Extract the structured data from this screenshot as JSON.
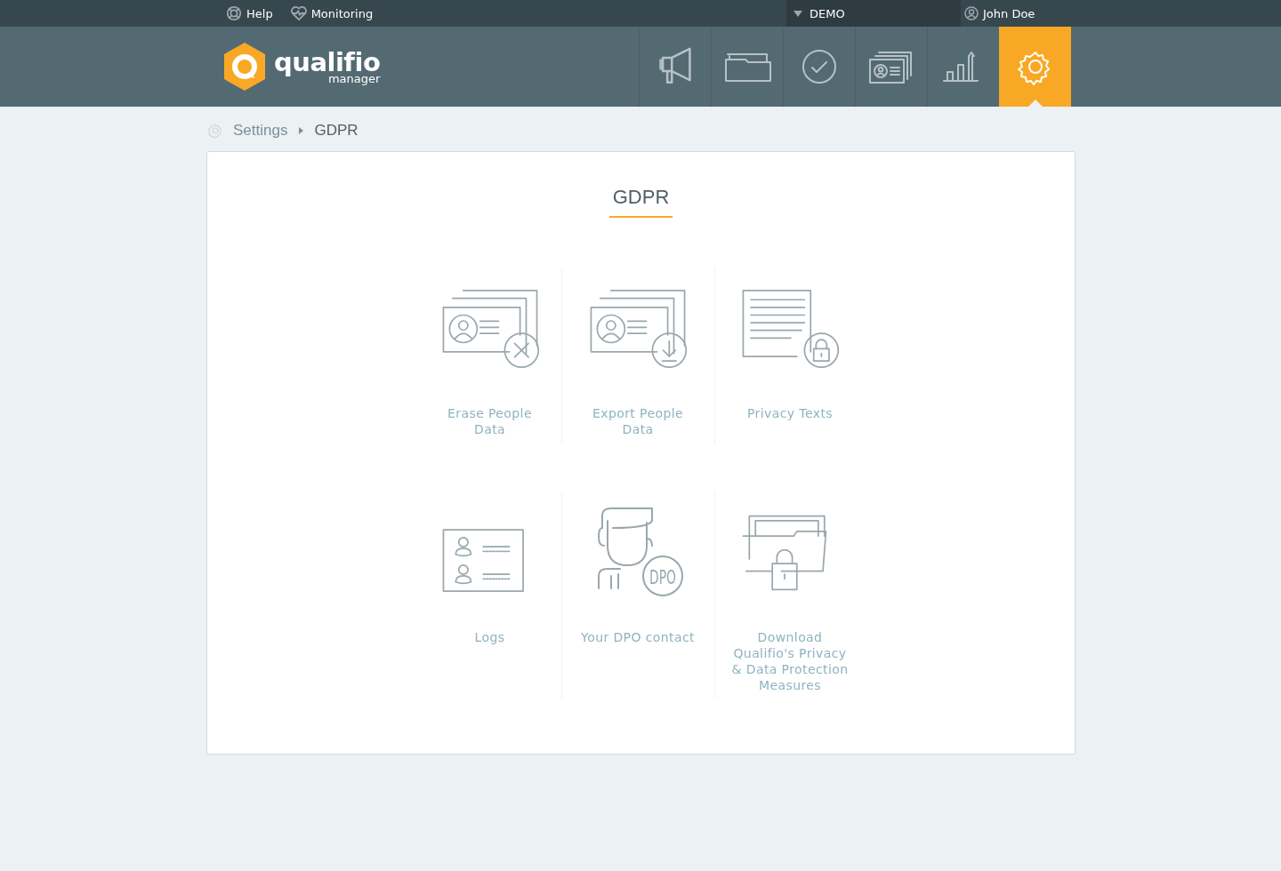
{
  "top_bar": {
    "links": [
      {
        "kind": "help",
        "label": "Help"
      },
      {
        "kind": "monitoring",
        "label": "Monitoring"
      }
    ],
    "workspace": "DEMO",
    "user": "John Doe"
  },
  "header": {
    "logo": {
      "name": "qualifio",
      "subtitle": "manager"
    },
    "nav": [
      {
        "kind": "campaigns",
        "selected": false
      },
      {
        "kind": "folders",
        "selected": false
      },
      {
        "kind": "validation",
        "selected": false
      },
      {
        "kind": "contacts",
        "selected": false
      },
      {
        "kind": "statistics",
        "selected": false
      },
      {
        "kind": "settings",
        "selected": true
      }
    ]
  },
  "breadcrumb": {
    "items": [
      "Settings",
      "GDPR"
    ]
  },
  "page": {
    "title": "GDPR",
    "tiles": [
      {
        "kind": "erase",
        "label": "Erase People\nData"
      },
      {
        "kind": "export",
        "label": "Export People\nData"
      },
      {
        "kind": "privacy",
        "label": "Privacy Texts"
      },
      {
        "kind": "logs",
        "label": "Logs"
      },
      {
        "kind": "dpo",
        "label": "Your DPO contact",
        "icon_text": "DPO"
      },
      {
        "kind": "download",
        "label": "Download\nQualifio's Privacy\n& Data Protection\nMeasures"
      }
    ]
  }
}
